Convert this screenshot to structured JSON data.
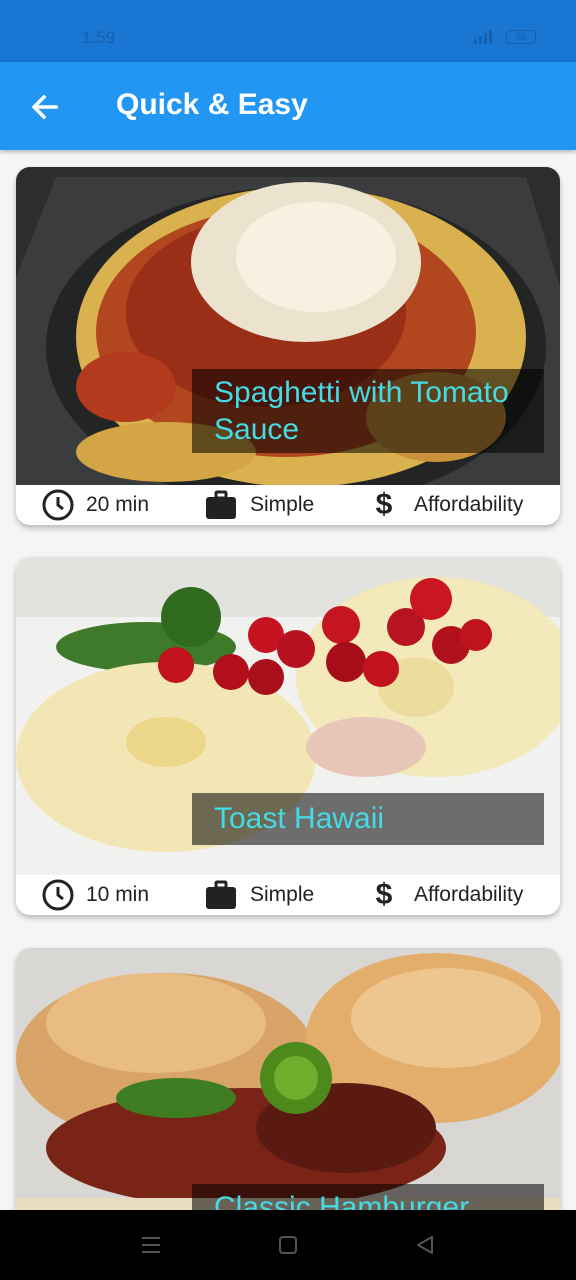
{
  "status_bar": {
    "time": "1:59",
    "battery": "58"
  },
  "app_bar": {
    "title": "Quick & Easy",
    "back_icon": "arrow-back-icon"
  },
  "meals": [
    {
      "title": "Spaghetti with Tomato Sauce",
      "duration": "20 min",
      "complexity": "Simple",
      "affordability": "Affordability"
    },
    {
      "title": "Toast Hawaii",
      "duration": "10 min",
      "complexity": "Simple",
      "affordability": "Affordability"
    },
    {
      "title": "Classic Hamburger"
    }
  ],
  "icons": {
    "duration": "clock-icon",
    "complexity": "briefcase-icon",
    "affordability": "dollar-icon"
  },
  "nav_bar": {
    "menu": "menu-lines-icon",
    "home": "home-square-icon",
    "back": "back-triangle-icon"
  },
  "colors": {
    "app_bar": "#2196f3",
    "status_bar": "#1976d2",
    "caption_text": "#45dbe5",
    "caption_bg": "rgba(0,0,0,0.55)"
  }
}
